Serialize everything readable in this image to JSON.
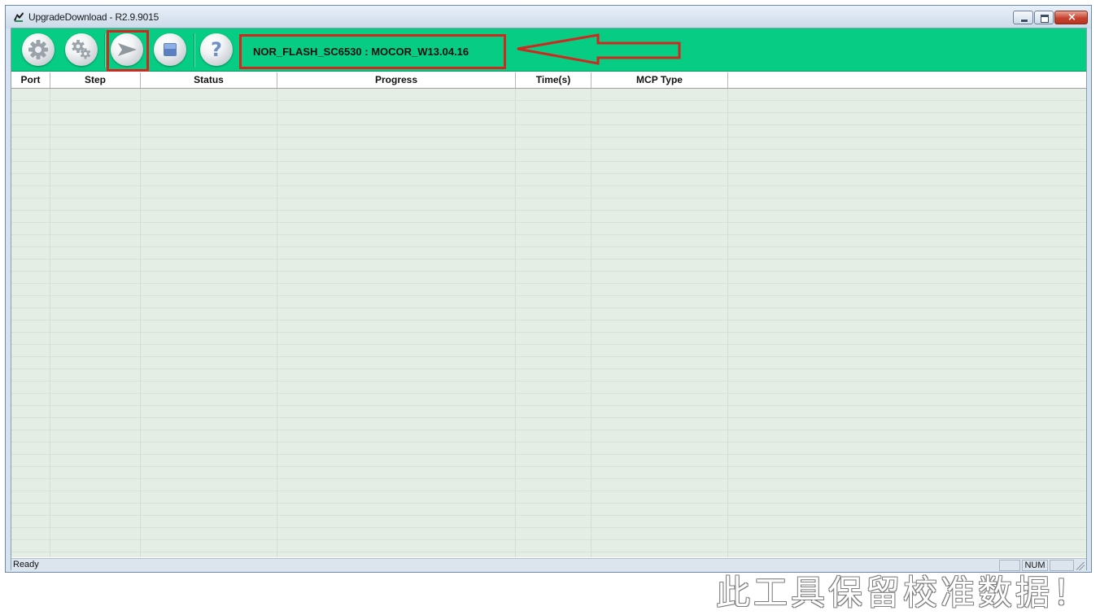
{
  "window": {
    "title": "UpgradeDownload - R2.9.9015",
    "controls": {
      "minimize": "minimize",
      "maximize": "maximize",
      "close": "×"
    }
  },
  "toolbar": {
    "buttons": [
      {
        "name": "settings-gear-icon"
      },
      {
        "name": "options-gears-icon"
      },
      {
        "name": "play-icon"
      },
      {
        "name": "stop-icon"
      },
      {
        "name": "help-icon",
        "glyph": "?"
      }
    ],
    "product_label": "NOR_FLASH_SC6530 : MOCOR_W13.04.16",
    "annotation_color": "#d0271f",
    "accent": "#06cd83"
  },
  "grid": {
    "columns": [
      "Port",
      "Step",
      "Status",
      "Progress",
      "Time(s)",
      "MCP Type"
    ],
    "rows": []
  },
  "watermark": "此工具保留校准数据！",
  "statusbar": {
    "text": "Ready",
    "indicators": [
      "",
      "NUM",
      ""
    ]
  }
}
